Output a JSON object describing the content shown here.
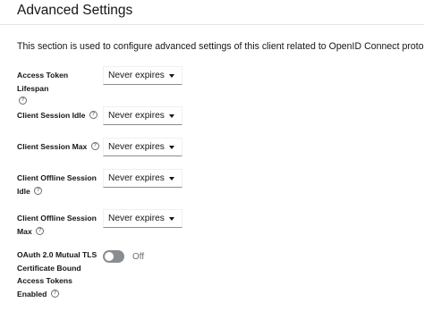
{
  "section": {
    "title": "Advanced Settings",
    "description": "This section is used to configure advanced settings of this client related to OpenID Connect protocol"
  },
  "settings": [
    {
      "label_line1": "Access Token Lifespan",
      "label_line2": "",
      "value": "Never expires"
    },
    {
      "label_line1": "Client Session Idle",
      "label_line2": "",
      "value": "Never expires"
    },
    {
      "label_line1": "Client Session Max",
      "label_line2": "",
      "value": "Never expires"
    },
    {
      "label_line1": "Client Offline Session",
      "label_line2": "Idle",
      "value": "Never expires"
    },
    {
      "label_line1": "Client Offline Session",
      "label_line2": "Max",
      "value": "Never expires"
    }
  ],
  "mtls": {
    "label_lines": [
      "OAuth 2.0 Mutual TLS",
      "Certificate Bound",
      "Access Tokens",
      "Enabled"
    ],
    "state_text": "Off"
  },
  "icons": {
    "help": "help-circle-icon",
    "caret": "caret-down-icon"
  },
  "colors": {
    "toggle_off": "#8a8d90",
    "border": "#8a8d90",
    "help_icon": "#6a6e73"
  }
}
